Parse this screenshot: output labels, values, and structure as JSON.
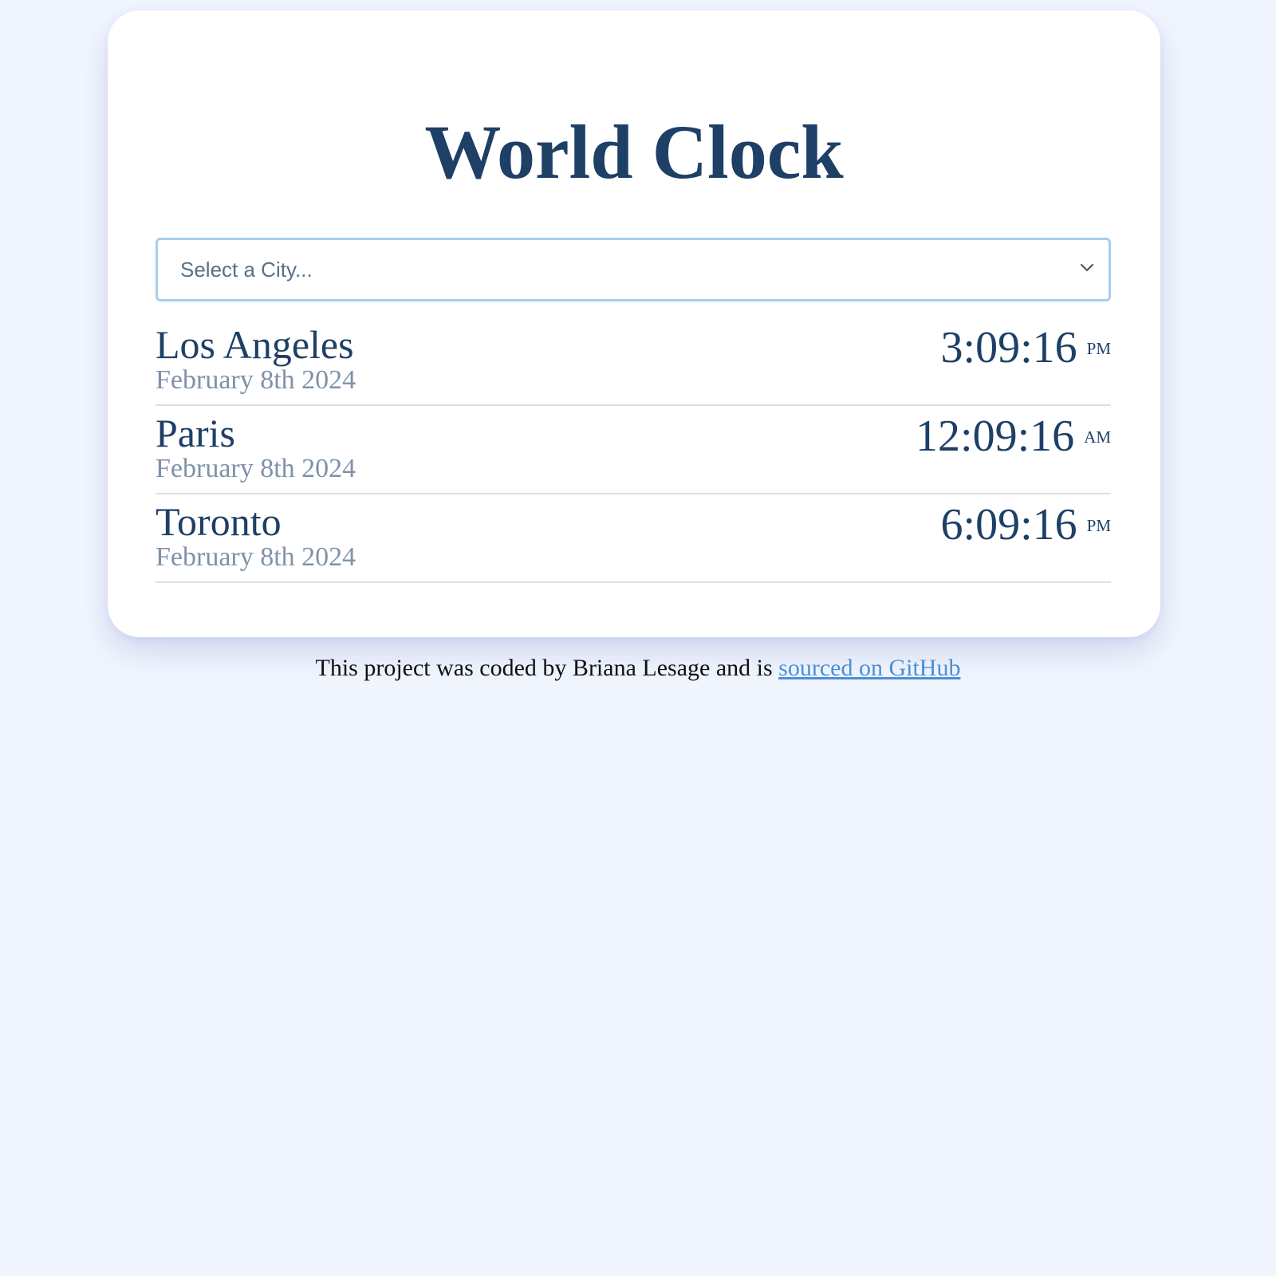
{
  "app": {
    "title": "World Clock"
  },
  "city_select": {
    "placeholder": "Select a City..."
  },
  "cities": [
    {
      "name": "Los Angeles",
      "date": "February 8th 2024",
      "time": "3:09:16",
      "ampm": "PM"
    },
    {
      "name": "Paris",
      "date": "February 8th 2024",
      "time": "12:09:16",
      "ampm": "AM"
    },
    {
      "name": "Toronto",
      "date": "February 8th 2024",
      "time": "6:09:16",
      "ampm": "PM"
    }
  ],
  "footer": {
    "text": "This project was coded by Briana Lesage and is ",
    "link_label": "sourced on GitHub"
  },
  "icons": {
    "select_arrow": "chevron-down-icon"
  },
  "colors": {
    "background": "#f1f6fe",
    "card": "#ffffff",
    "primary_text": "#1e4066",
    "muted_text": "#7f92a8",
    "select_border": "#a9cdec",
    "link": "#4a8fd6"
  }
}
